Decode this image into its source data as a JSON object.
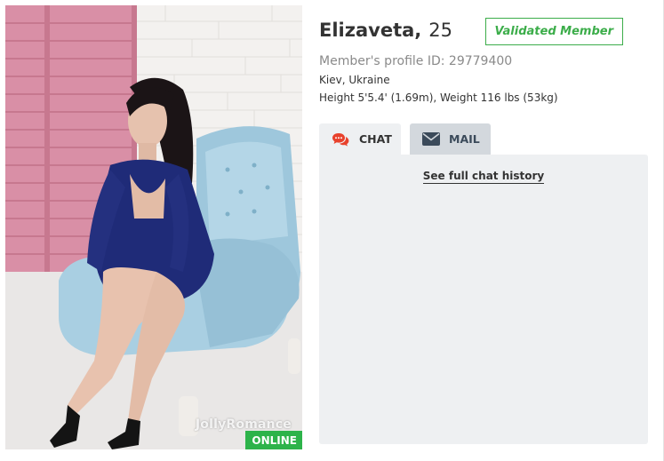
{
  "profile": {
    "name": "Elizaveta,",
    "age": "25",
    "validated_label": "Validated Member",
    "profile_id": "Member's profile ID: 29779400",
    "location": "Kiev, Ukraine",
    "measurements": "Height 5'5.4' (1.69m), Weight 116 lbs (53kg)"
  },
  "photo": {
    "watermark": "JollyRomance",
    "status_badge": "ONLINE"
  },
  "tabs": [
    {
      "label": "CHAT",
      "icon": "chat-bubbles-icon",
      "active": true
    },
    {
      "label": "MAIL",
      "icon": "envelope-icon",
      "active": false
    }
  ],
  "chat_panel": {
    "history_link": "See full chat history"
  },
  "colors": {
    "accent_green": "#3cad4a",
    "online_green": "#2db34a",
    "chat_icon_red": "#e8412c",
    "mail_icon_dark": "#3b4a5a",
    "panel_bg": "#eef0f2",
    "inactive_tab_bg": "#d3d8dd"
  }
}
